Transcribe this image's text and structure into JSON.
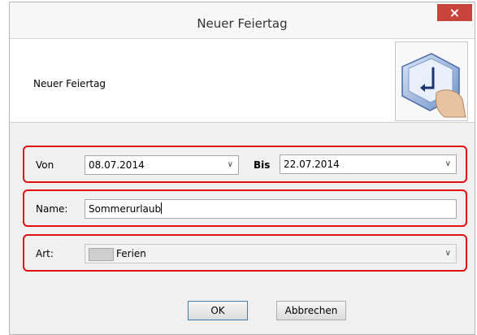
{
  "window": {
    "title": "Neuer Feiertag",
    "close_glyph": "×"
  },
  "header": {
    "label": "Neuer Feiertag",
    "icon": "keyboard-key-press-icon"
  },
  "date_range": {
    "from_label": "Von",
    "from_value": "08.07.2014",
    "to_label": "Bis",
    "to_value": "22.07.2014"
  },
  "name": {
    "label": "Name:",
    "value": "Sommerurlaub"
  },
  "type": {
    "label": "Art:",
    "value": "Ferien",
    "swatch_color": "#cfcfcf"
  },
  "buttons": {
    "ok": "OK",
    "cancel": "Abbrechen"
  },
  "colors": {
    "highlight": "#e01010",
    "close_bg": "#c7443a"
  }
}
